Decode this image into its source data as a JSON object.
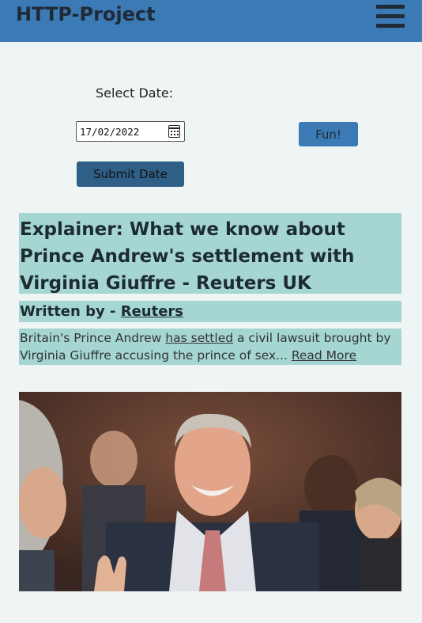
{
  "header": {
    "title": "HTTP-Project",
    "menu_icon": "hamburger-menu-icon"
  },
  "controls": {
    "date_label": "Select Date:",
    "date_value": "17/02/2022",
    "fun_label": "Fun!",
    "submit_label": "Submit Date"
  },
  "article": {
    "title": "Explainer: What we know about Prince Andrew's settlement with Virginia Giuffre - Reuters UK",
    "written_by_prefix": "Written by - ",
    "author": "Reuters",
    "summary_part1": "Britain's Prince Andrew ",
    "summary_link": "has settled",
    "summary_part2": " a civil lawsuit brought by Virginia Giuffre accusing the prince of sex... ",
    "read_more": "Read More"
  },
  "colors": {
    "header": "#3b7ab5",
    "card": "#a5d6d1",
    "background": "#eef5f4",
    "submit": "#2f5f87"
  }
}
